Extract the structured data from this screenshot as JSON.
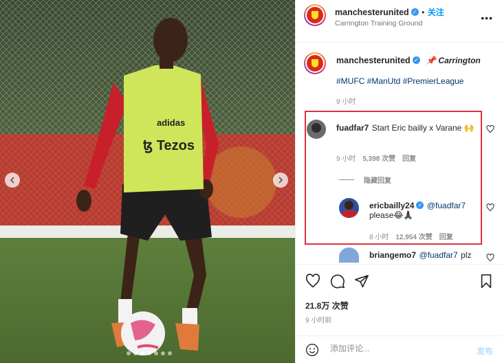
{
  "header": {
    "username": "manchesterunited",
    "follow_label": "关注",
    "location": "Carrington Training Ground",
    "more_icon": "more-horizontal-icon"
  },
  "caption": {
    "username": "manchesterunited",
    "text": "📌 Carrington",
    "hashtags": "#MUFC #ManUtd #PremierLeague",
    "time": "9 小时"
  },
  "comments": [
    {
      "username": "fuadfar7",
      "text": "Start Eric bailly x Varane 🙌",
      "time": "9 小时",
      "likes": "5,398 次赞",
      "reply_label": "回复",
      "hide_replies_label": "隐藏回复"
    }
  ],
  "reply": {
    "username": "ericbailly24",
    "mention": "@fuadfar7",
    "text": "please😂🙏🏿",
    "time": "8 小时",
    "likes": "12,954 次赞",
    "reply_label": "回复"
  },
  "partial_comment": {
    "username": "briangemo7",
    "mention": "@fuadfar7",
    "text": "plz"
  },
  "actions": {
    "likes": "21.8万 次赞",
    "posted_time": "9 小时前",
    "comment_placeholder": "添加评论...",
    "post_label": "发布"
  },
  "photo": {
    "bib_brand": "adidas",
    "bib_sponsor": "Tezos",
    "dots": 7,
    "active_dot": 3
  },
  "colors": {
    "accent_blue": "#0095f6",
    "highlight_red": "#d9323a",
    "mu_red": "#da291c"
  }
}
